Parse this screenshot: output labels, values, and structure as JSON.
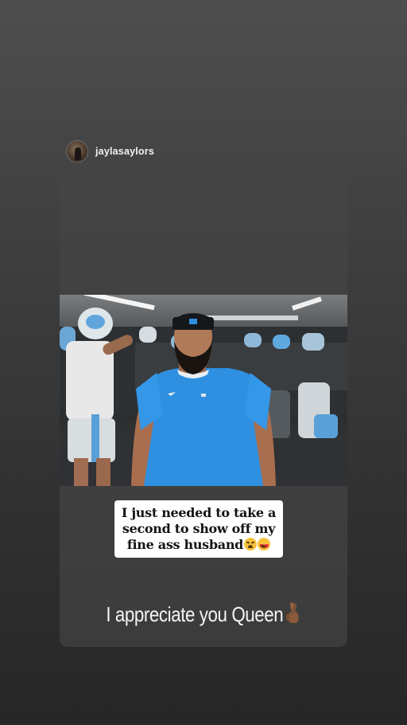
{
  "story": {
    "username": "jaylasaylors",
    "avatar_icon": "profile-avatar",
    "photo_description_icon": "story-photo",
    "caption_line1": "I just needed to take a",
    "caption_line2": "second to show off my",
    "caption_line3": "fine ass husband",
    "caption_emojis": [
      "weary-face-emoji",
      "heart-eyes-emoji"
    ],
    "reply_text": "I appreciate you Queen",
    "reply_emoji": "crossed-fingers-emoji"
  },
  "colors": {
    "background_top": "#4e4e4e",
    "background_bottom": "#262626",
    "card": "#414141",
    "caption_box": "#ffffff",
    "shirt_blue": "#2f8fe0"
  }
}
